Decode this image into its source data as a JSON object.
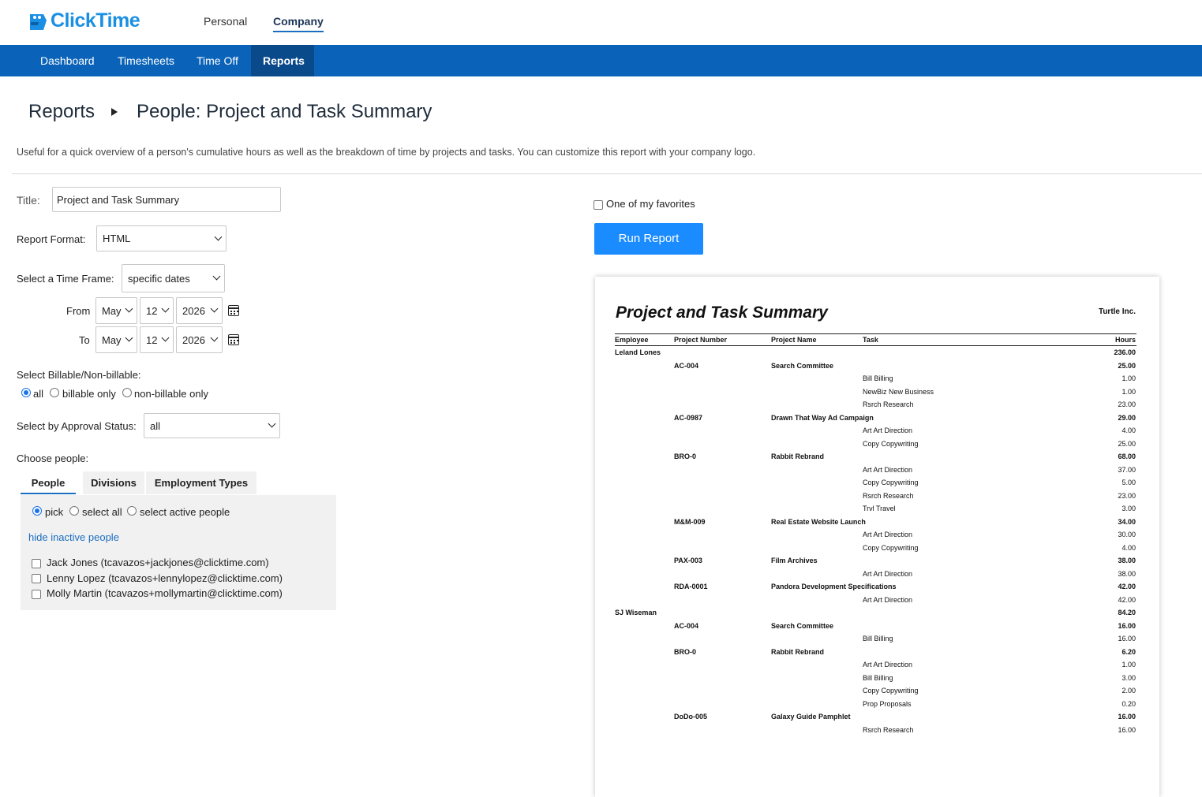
{
  "app": {
    "name": "ClickTime"
  },
  "topnav": {
    "personal": "Personal",
    "company": "Company"
  },
  "nav": {
    "dashboard": "Dashboard",
    "timesheets": "Timesheets",
    "time_off": "Time Off",
    "reports": "Reports"
  },
  "breadcrumb": {
    "root": "Reports",
    "current": "People: Project and Task Summary"
  },
  "description": "Useful for a quick overview of a person's cumulative hours as well as the breakdown of time by projects and tasks. You can customize this report with your company logo.",
  "form": {
    "title_label": "Title:",
    "title_value": "Project and Task Summary",
    "format_label": "Report Format:",
    "format_value": "HTML",
    "timeframe_label": "Select a Time Frame:",
    "timeframe_value": "specific dates",
    "from_label": "From",
    "to_label": "To",
    "from": {
      "month": "May",
      "day": "12",
      "year": "2026"
    },
    "to": {
      "month": "May",
      "day": "12",
      "year": "2026"
    },
    "billable_label": "Select Billable/Non-billable:",
    "billable_options": [
      "all",
      "billable only",
      "non-billable only"
    ],
    "billable_selected": "all",
    "approval_label": "Select by Approval Status:",
    "approval_value": "all",
    "choose_people_label": "Choose people:",
    "tabs": [
      "People",
      "Divisions",
      "Employment Types"
    ],
    "pick_options": [
      "pick",
      "select all",
      "select active people"
    ],
    "hide_inactive": "hide inactive people",
    "people": [
      "Jack Jones (tcavazos+jackjones@clicktime.com)",
      "Lenny Lopez (tcavazos+lennylopez@clicktime.com)",
      "Molly Martin (tcavazos+mollymartin@clicktime.com)"
    ],
    "favorites_label": "One of my favorites",
    "run_button": "Run Report"
  },
  "preview": {
    "title": "Project and Task Summary",
    "company": "Turtle Inc.",
    "headers": {
      "employee": "Employee",
      "project_number": "Project Number",
      "project_name": "Project Name",
      "task": "Task",
      "hours": "Hours"
    },
    "rows": [
      {
        "kind": "employee",
        "employee": "Leland Lones",
        "hours": "236.00"
      },
      {
        "kind": "project",
        "number": "AC-004",
        "name": "Search Committee",
        "hours": "25.00"
      },
      {
        "kind": "task",
        "task": "Bill Billing",
        "hours": "1.00"
      },
      {
        "kind": "task",
        "task": "NewBiz New Business",
        "hours": "1.00"
      },
      {
        "kind": "task",
        "task": "Rsrch Research",
        "hours": "23.00"
      },
      {
        "kind": "project",
        "number": "AC-0987",
        "name": "Drawn That Way Ad Campaign",
        "hours": "29.00"
      },
      {
        "kind": "task",
        "task": "Art Art Direction",
        "hours": "4.00"
      },
      {
        "kind": "task",
        "task": "Copy Copywriting",
        "hours": "25.00"
      },
      {
        "kind": "project",
        "number": "BRO-0",
        "name": "Rabbit Rebrand",
        "hours": "68.00"
      },
      {
        "kind": "task",
        "task": "Art Art Direction",
        "hours": "37.00"
      },
      {
        "kind": "task",
        "task": "Copy Copywriting",
        "hours": "5.00"
      },
      {
        "kind": "task",
        "task": "Rsrch Research",
        "hours": "23.00"
      },
      {
        "kind": "task",
        "task": "Trvl Travel",
        "hours": "3.00"
      },
      {
        "kind": "project",
        "number": "M&M-009",
        "name": "Real Estate Website Launch",
        "hours": "34.00"
      },
      {
        "kind": "task",
        "task": "Art Art Direction",
        "hours": "30.00"
      },
      {
        "kind": "task",
        "task": "Copy Copywriting",
        "hours": "4.00"
      },
      {
        "kind": "project",
        "number": "PAX-003",
        "name": "Film Archives",
        "hours": "38.00"
      },
      {
        "kind": "task",
        "task": "Art Art Direction",
        "hours": "38.00"
      },
      {
        "kind": "project",
        "number": "RDA-0001",
        "name": "Pandora Development Specifications",
        "hours": "42.00"
      },
      {
        "kind": "task",
        "task": "Art Art Direction",
        "hours": "42.00"
      },
      {
        "kind": "employee",
        "employee": "SJ Wiseman",
        "hours": "84.20"
      },
      {
        "kind": "project",
        "number": "AC-004",
        "name": "Search Committee",
        "hours": "16.00"
      },
      {
        "kind": "task",
        "task": "Bill Billing",
        "hours": "16.00"
      },
      {
        "kind": "project",
        "number": "BRO-0",
        "name": "Rabbit Rebrand",
        "hours": "6.20"
      },
      {
        "kind": "task",
        "task": "Art Art Direction",
        "hours": "1.00"
      },
      {
        "kind": "task",
        "task": "Bill Billing",
        "hours": "3.00"
      },
      {
        "kind": "task",
        "task": "Copy Copywriting",
        "hours": "2.00"
      },
      {
        "kind": "task",
        "task": "Prop Proposals",
        "hours": "0.20"
      },
      {
        "kind": "project",
        "number": "DoDo-005",
        "name": "Galaxy Guide Pamphlet",
        "hours": "16.00"
      },
      {
        "kind": "task",
        "task": "Rsrch Research",
        "hours": "16.00"
      }
    ]
  },
  "colors": {
    "nav": "#0a63b8",
    "nav_active": "#0b4a8a",
    "accent": "#1a8cff",
    "link": "#1a6ec1",
    "logo": "#1a8fe3"
  }
}
